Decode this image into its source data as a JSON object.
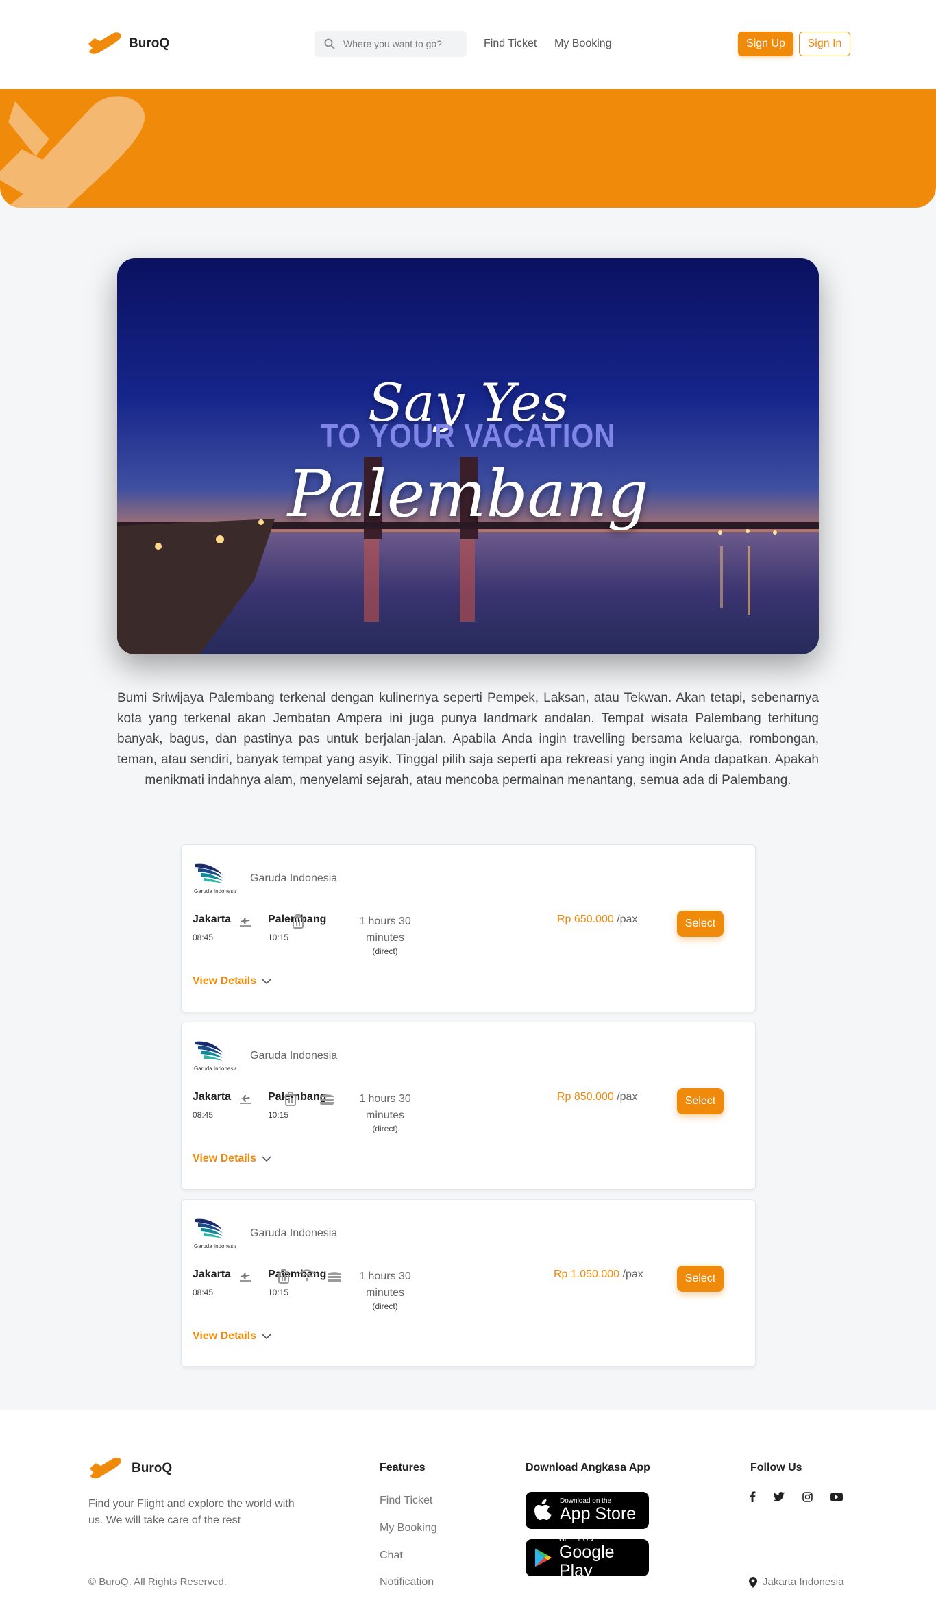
{
  "header": {
    "brand": "BuroQ",
    "search_placeholder": "Where you want to go?",
    "nav": [
      "Find Ticket",
      "My Booking"
    ],
    "signup": "Sign Up",
    "signin": "Sign In"
  },
  "hero": {
    "line1": "Say Yes",
    "line2": "TO YOUR VACATION",
    "city": "Palembang"
  },
  "description": "Bumi Sriwijaya Palembang terkenal dengan kulinernya seperti Pempek, Laksan, atau Tekwan. Akan tetapi, sebenarnya kota yang terkenal akan Jembatan Ampera ini juga punya landmark andalan. Tempat wisata Palembang terhitung banyak, bagus, dan pastinya pas untuk berjalan-jalan. Apabila Anda ingin travelling bersama keluarga, rombongan, teman, atau sendiri, banyak tempat yang asyik. Tinggal pilih saja seperti apa rekreasi yang ingin Anda dapatkan. Apakah menikmati indahnya alam, menyelami sejarah, atau mencoba permainan menantang, semua ada di Palembang.",
  "flights": [
    {
      "airline": "Garuda Indonesia",
      "logo_caption": "Garuda Indonesia",
      "from": "Jakarta",
      "from_time": "08:45",
      "to": "Palembang",
      "to_time": "10:15",
      "duration": "1 hours 30 minutes",
      "type": "(direct)",
      "facilities": [
        "luggage-icon"
      ],
      "price": "Rp 650.000",
      "unit": "/pax",
      "select": "Select",
      "details": "View Details"
    },
    {
      "airline": "Garuda Indonesia",
      "logo_caption": "Garuda Indonesia",
      "from": "Jakarta",
      "from_time": "08:45",
      "to": "Palembang",
      "to_time": "10:15",
      "duration": "1 hours 30 minutes",
      "type": "(direct)",
      "facilities": [
        "luggage-icon",
        "meal-icon"
      ],
      "price": "Rp 850.000",
      "unit": "/pax",
      "select": "Select",
      "details": "View Details"
    },
    {
      "airline": "Garuda Indonesia",
      "logo_caption": "Garuda Indonesia",
      "from": "Jakarta",
      "from_time": "08:45",
      "to": "Palembang",
      "to_time": "10:15",
      "duration": "1 hours 30 minutes",
      "type": "(direct)",
      "facilities": [
        "luggage-icon",
        "wifi-icon",
        "meal-icon"
      ],
      "price": "Rp 1.050.000",
      "unit": "/pax",
      "select": "Select",
      "details": "View Details"
    }
  ],
  "footer": {
    "brand": "BuroQ",
    "tagline": "Find your Flight and explore the world with us. We will take care of the rest",
    "copyright": "© BuroQ. All Rights Reserved.",
    "features_heading": "Features",
    "features": [
      "Find Ticket",
      "My Booking",
      "Chat",
      "Notification"
    ],
    "download_heading": "Download Angkasa App",
    "appstore_small": "Download on the",
    "appstore_big": "App Store",
    "googleplay_small": "GET IT ON",
    "googleplay_big": "Google Play",
    "follow_heading": "Follow Us",
    "socials": [
      "facebook-icon",
      "twitter-icon",
      "instagram-icon",
      "youtube-icon"
    ],
    "location": "Jakarta Indonesia"
  },
  "colors": {
    "accent": "#f08a0b"
  }
}
